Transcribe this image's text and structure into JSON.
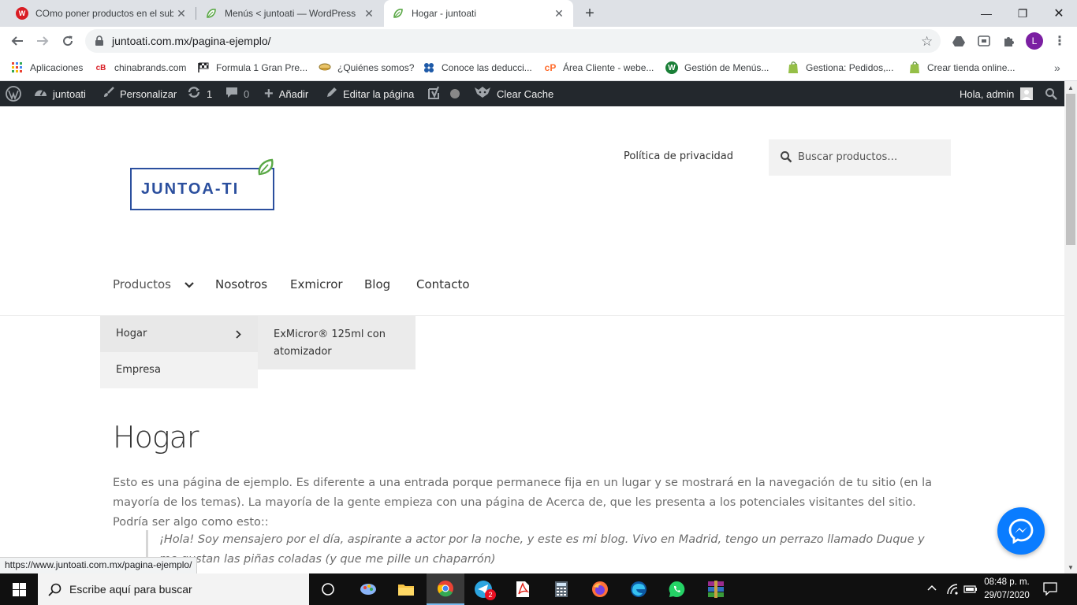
{
  "browser": {
    "tabs": [
      {
        "title": "COmo poner productos en el sub",
        "favicon": "wordpress-red-icon",
        "color": "#d91d24",
        "active": false
      },
      {
        "title": "Menús < juntoati — WordPress",
        "favicon": "leaf-icon",
        "color": "#5aa846",
        "active": false
      },
      {
        "title": "Hogar - juntoati",
        "favicon": "leaf-icon",
        "color": "#5aa846",
        "active": true
      }
    ],
    "url": "juntoati.com.mx/pagina-ejemplo/",
    "profile_initial": "L",
    "bookmarks": [
      {
        "label": "Aplicaciones",
        "icon": "apps-grid-icon"
      },
      {
        "label": "chinabrands.com",
        "icon": "chinabrands-icon"
      },
      {
        "label": "Formula 1 Gran Pre...",
        "icon": "checkered-flag-icon"
      },
      {
        "label": "¿Quiénes somos?",
        "icon": "bowl-icon"
      },
      {
        "label": "Conoce las deducci...",
        "icon": "sat-icon"
      },
      {
        "label": "Área Cliente - webe...",
        "icon": "cpanel-icon"
      },
      {
        "label": "Gestión de Menús...",
        "icon": "wordpress-green-icon"
      },
      {
        "label": "Gestiona: Pedidos,...",
        "icon": "shopify-icon"
      },
      {
        "label": "Crear tienda online...",
        "icon": "shopify-icon"
      }
    ]
  },
  "adminbar": {
    "site_name": "juntoati",
    "customize": "Personalizar",
    "updates": "1",
    "comments": "0",
    "add_new": "Añadir",
    "edit_page": "Editar la página",
    "clear_cache": "Clear Cache",
    "greeting": "Hola, admin"
  },
  "site": {
    "logo_text": "JUNTOA-TI",
    "header_link": "Política de privacidad",
    "search_placeholder": "Buscar productos…",
    "nav": [
      "Productos",
      "Nosotros",
      "Exmicror",
      "Blog",
      "Contacto"
    ],
    "submenu": [
      "Hogar",
      "Empresa"
    ],
    "submenu2_line1": "ExMicror® 125ml con",
    "submenu2_line2": "atomizador",
    "page_title": "Hogar",
    "paragraph": "Esto es una página de ejemplo. Es diferente a una entrada porque permanece fija en un lugar y se mostrará en la navegación de tu sitio (en la mayoría de los temas). La mayoría de la gente empieza con una página de Acerca de, que les presenta a los potenciales visitantes del sitio. Podría ser algo como esto::",
    "quote": "¡Hola! Soy mensajero por el día, aspirante a actor por la noche, y este es mi blog. Vivo en Madrid, tengo un perrazo llamado Duque y me gustan las piñas coladas (y que me pille un chaparrón)"
  },
  "status_url": "https://www.juntoati.com.mx/pagina-ejemplo/",
  "taskbar": {
    "search_placeholder": "Escribe aquí para buscar",
    "telegram_badge": "2",
    "time": "08:48 p. m.",
    "date": "29/07/2020"
  },
  "colors": {
    "wp_admin_bar": "#23282d",
    "logo_blue": "#2b4f9e",
    "leaf_green": "#5aa846",
    "messenger_blue": "#0a7cff"
  }
}
